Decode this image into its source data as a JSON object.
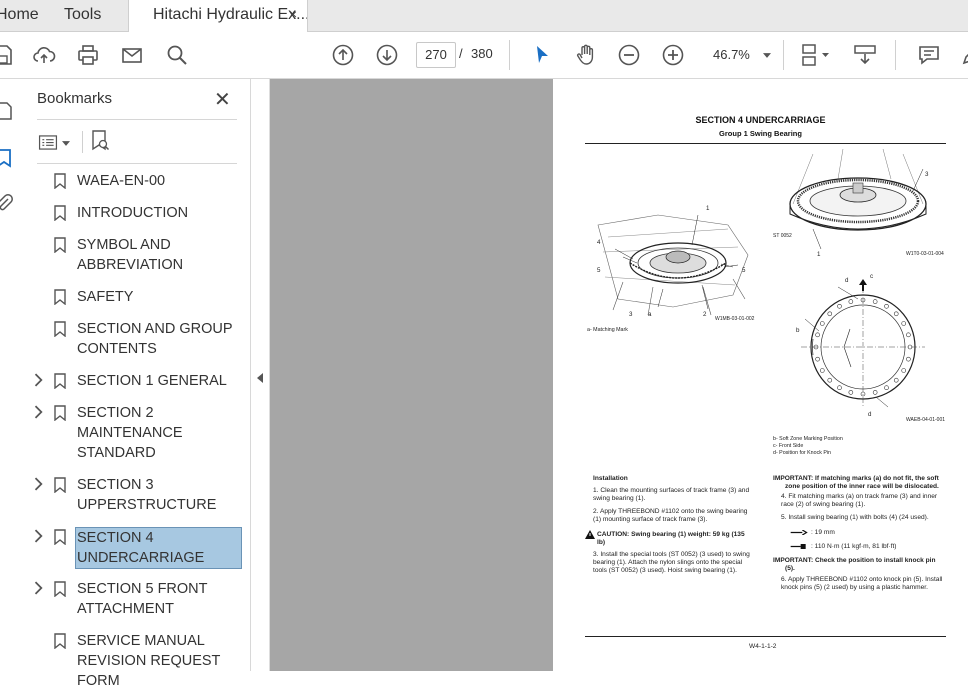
{
  "tabs": [
    {
      "label": "Home"
    },
    {
      "label": "Tools"
    },
    {
      "label": "Hitachi Hydraulic Ex...",
      "close": "×"
    }
  ],
  "toolbar": {
    "page_current": "270",
    "page_sep": "/",
    "page_total": "380",
    "zoom": "46.7%"
  },
  "bookmarks": {
    "title": "Bookmarks",
    "close": "✕",
    "items": [
      {
        "lines": [
          "WAEA-EN-00"
        ],
        "expandable": false
      },
      {
        "lines": [
          "INTRODUCTION"
        ],
        "expandable": false
      },
      {
        "lines": [
          "SYMBOL AND",
          "ABBREVIATION"
        ],
        "expandable": false
      },
      {
        "lines": [
          "SAFETY"
        ],
        "expandable": false
      },
      {
        "lines": [
          "SECTION AND GROUP",
          "CONTENTS"
        ],
        "expandable": false
      },
      {
        "lines": [
          "SECTION 1 GENERAL"
        ],
        "expandable": true
      },
      {
        "lines": [
          "SECTION 2",
          "MAINTENANCE",
          "STANDARD"
        ],
        "expandable": true
      },
      {
        "lines": [
          "SECTION 3",
          "UPPERSTRUCTURE"
        ],
        "expandable": true
      },
      {
        "lines": [
          "SECTION 4",
          "UNDERCARRIAGE"
        ],
        "expandable": true,
        "selected": true
      },
      {
        "lines": [
          "SECTION 5 FRONT",
          "ATTACHMENT"
        ],
        "expandable": true
      },
      {
        "lines": [
          "SERVICE MANUAL",
          "REVISION REQUEST",
          "FORM"
        ],
        "expandable": false
      }
    ]
  },
  "doc": {
    "section_title": "SECTION 4 UNDERCARRIAGE",
    "group_title": "Group 1 Swing Bearing",
    "fig1_code": "W1MB-03-01-002",
    "fig1_note": "a-    Matching Mark",
    "fig2_code": "W1T0-03-01-004",
    "fig2_tool": "ST 0052",
    "fig3_code": "WAEB-04-01-001",
    "fig3_legend": [
      "b-    Soft Zone Marking Position",
      "c-    Front Side",
      "d-    Position for Knock Pin"
    ],
    "callouts": {
      "n1": "1",
      "n2": "2",
      "n3": "3",
      "n4": "4",
      "n5": "5",
      "a": "a",
      "b": "b",
      "c": "c",
      "d": "d"
    },
    "install_heading": "Installation",
    "left_steps": [
      "1.  Clean the mounting surfaces of track frame (3) and",
      "     swing bearing (1).",
      "2.  Apply THREEBOND #1102 onto the swing bearing",
      "     (1) mounting surface of track frame (3)."
    ],
    "caution": [
      "CAUTION:    Swing bearing (1) weight: 59 kg (135",
      "lb)"
    ],
    "left_step3": [
      "3.  Install the special tools (ST 0052) (3 used) to swing",
      "     bearing (1). Attach the nylon slings onto the special",
      "     tools (ST 0052) (3 used). Hoist swing bearing (1)."
    ],
    "important1": [
      "IMPORTANT:    If matching marks (a) do not fit, the soft",
      "zone position of the inner race will be dislocated."
    ],
    "right_steps": [
      "4.  Fit matching marks (a) on track frame (3) and inner",
      "     race (2) of swing bearing (1).",
      "5.  Install swing bearing (1) with bolts (4) (24 used)."
    ],
    "wrench": ": 19 mm",
    "torque": ": 110 N·m (11 kgf·m, 81 lbf·ft)",
    "important2": [
      "IMPORTANT:    Check the position to install knock pin",
      "(5)."
    ],
    "right_step6": [
      "6.  Apply THREEBOND #1102 onto knock pin (5). Install",
      "     knock pins (5) (2 used) by using a plastic hammer."
    ],
    "page_number": "W4-1-1-2"
  }
}
